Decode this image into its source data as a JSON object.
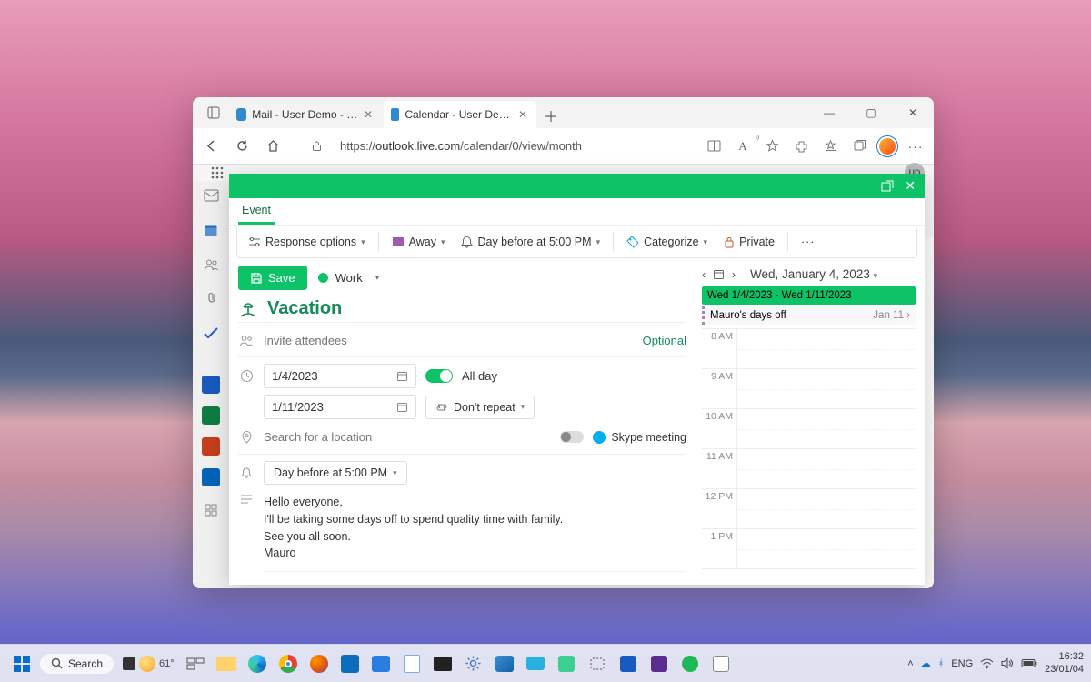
{
  "browser": {
    "tabs": [
      {
        "label": "Mail - User Demo - Outlook",
        "active": false,
        "favicon": "#0f6cbd"
      },
      {
        "label": "Calendar - User Demo - Outloo…",
        "active": true,
        "favicon": "#0f6cbd"
      }
    ],
    "url_plain": "https://",
    "url_host": "outlook.live.com",
    "url_path": "/calendar/0/view/month"
  },
  "app": {
    "avatar_initials": "UD"
  },
  "modal": {
    "tab": "Event",
    "ribbon": {
      "response": "Response options",
      "showas": "Away",
      "reminder": "Day before at 5:00 PM",
      "categorize": "Categorize",
      "private": "Private"
    },
    "save": "Save",
    "calendar": "Work",
    "title": "Vacation",
    "attendees_placeholder": "Invite attendees",
    "optional": "Optional",
    "start": "1/4/2023",
    "end": "1/11/2023",
    "allday": "All day",
    "repeat": "Don't repeat",
    "location_placeholder": "Search for a location",
    "skype": "Skype meeting",
    "reminder2": "Day before at 5:00 PM",
    "description": "Hello everyone,\nI'll be taking some days off to spend quality time with family.\nSee you all soon.\nMauro"
  },
  "daycal": {
    "date": "Wed, January 4, 2023",
    "alldays": "Wed 1/4/2023 - Wed 1/11/2023",
    "event": {
      "title": "Mauro's days off",
      "right": "Jan 11 ›"
    },
    "hours": [
      "8 AM",
      "9 AM",
      "10 AM",
      "11 AM",
      "12 PM",
      "1 PM"
    ]
  },
  "taskbar": {
    "search": "Search",
    "temp": "61°",
    "tray": {
      "lang": "ENG",
      "time": "16:32",
      "date": "23/01/04"
    }
  }
}
